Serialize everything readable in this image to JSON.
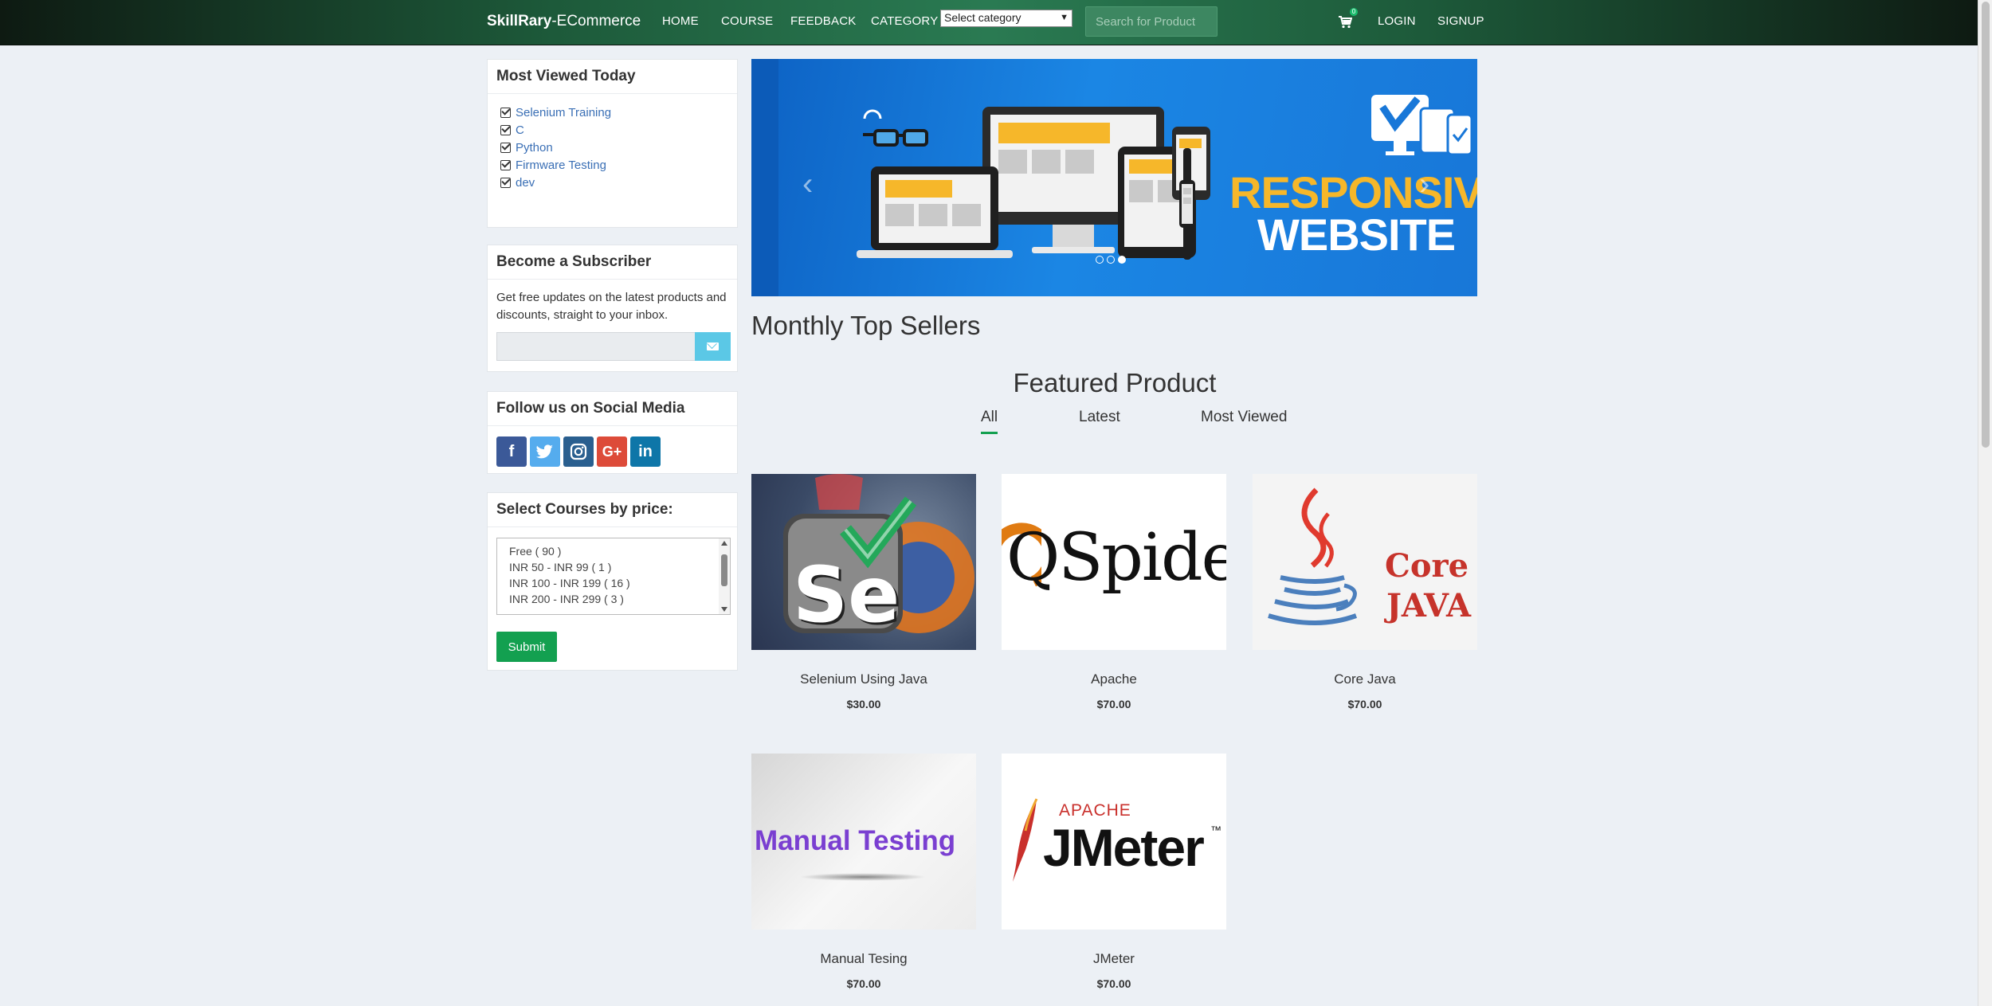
{
  "navbar": {
    "brand_bold": "SkillRary",
    "brand_rest": "-ECommerce",
    "links": [
      "HOME",
      "COURSE",
      "FEEDBACK",
      "CATEGORY"
    ],
    "category_select": "Select category",
    "search_placeholder": "Search for Product",
    "cart_count": "0",
    "login": "LOGIN",
    "signup": "SIGNUP"
  },
  "most_viewed": {
    "title": "Most Viewed Today",
    "items": [
      "Selenium Training",
      "C",
      "Python",
      "Firmware Testing",
      "dev"
    ]
  },
  "subscriber": {
    "title": "Become a Subscriber",
    "text": "Get free updates on the latest products and discounts, straight to your inbox."
  },
  "social": {
    "title": "Follow us on Social Media",
    "icons": [
      "facebook-icon",
      "twitter-icon",
      "instagram-icon",
      "google-plus-icon",
      "linkedin-icon"
    ]
  },
  "price_filter": {
    "title": "Select Courses by price:",
    "options": [
      "Free ( 90 )",
      "INR 50 - INR 99 ( 1 )",
      "INR 100 - INR 199 ( 16 )",
      "INR 200 - INR 299 ( 3 )"
    ],
    "submit": "Submit"
  },
  "banner": {
    "line1": "RESPONSIVE",
    "line2": "WEBSITE"
  },
  "headings": {
    "top_sellers": "Monthly Top Sellers",
    "featured": "Featured Product"
  },
  "tabs": [
    "All",
    "Latest",
    "Most Viewed"
  ],
  "products": [
    {
      "name": "Selenium Using Java",
      "price": "$30.00"
    },
    {
      "name": "Apache",
      "price": "$70.00"
    },
    {
      "name": "Core Java",
      "price": "$70.00"
    },
    {
      "name": "Manual Tesing",
      "price": "$70.00"
    },
    {
      "name": "JMeter",
      "price": "$70.00"
    }
  ],
  "product_image_text": {
    "selenium": "Se",
    "qspiders": "QSpiders",
    "corejava_1": "Core",
    "corejava_2": "JAVA",
    "manual": "Manual Testing",
    "jmeter_1": "APACHE",
    "jmeter_2": "JMeter",
    "jmeter_tm": "™"
  },
  "colors": {
    "accent_green": "#13a050",
    "link_blue": "#3a6fb5",
    "subscribe_button": "#5bc8e6"
  }
}
